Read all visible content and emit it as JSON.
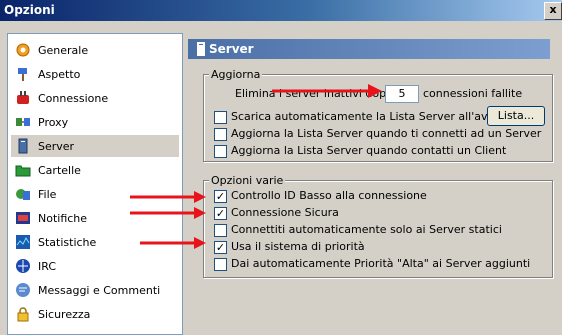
{
  "window": {
    "title": "Opzioni",
    "close_glyph": "x"
  },
  "sidebar": {
    "items": [
      {
        "label": "Generale",
        "icon": "gear-icon"
      },
      {
        "label": "Aspetto",
        "icon": "paint-icon"
      },
      {
        "label": "Connessione",
        "icon": "connection-icon"
      },
      {
        "label": "Proxy",
        "icon": "proxy-icon"
      },
      {
        "label": "Server",
        "icon": "server-icon",
        "selected": true
      },
      {
        "label": "Cartelle",
        "icon": "folder-icon"
      },
      {
        "label": "File",
        "icon": "file-icon"
      },
      {
        "label": "Notifiche",
        "icon": "notification-icon"
      },
      {
        "label": "Statistiche",
        "icon": "statistics-icon"
      },
      {
        "label": "IRC",
        "icon": "irc-icon"
      },
      {
        "label": "Messaggi e Commenti",
        "icon": "messages-icon"
      },
      {
        "label": "Sicurezza",
        "icon": "lock-icon"
      }
    ]
  },
  "header": {
    "title": "Server"
  },
  "aggiorna": {
    "legend": "Aggiorna",
    "remove_prefix": "Elimina i server inattivi dopo",
    "remove_value": "5",
    "remove_suffix": "connessioni fallite",
    "options": [
      {
        "label": "Scarica automaticamente la Lista Server all'avvio",
        "checked": false
      },
      {
        "label": "Aggiorna la Lista Server quando ti connetti ad un Server",
        "checked": false
      },
      {
        "label": "Aggiorna la Lista Server quando contatti un Client",
        "checked": false
      }
    ],
    "list_button": "Lista..."
  },
  "varie": {
    "legend": "Opzioni varie",
    "options": [
      {
        "label": "Controllo ID Basso alla connessione",
        "checked": true
      },
      {
        "label": "Connessione Sicura",
        "checked": true
      },
      {
        "label": "Connettiti automaticamente solo ai Server statici",
        "checked": false
      },
      {
        "label": "Usa il sistema di priorità",
        "checked": true
      },
      {
        "label": "Dai automaticamente Priorità \"Alta\" ai Server aggiunti",
        "checked": false
      }
    ]
  },
  "colors": {
    "arrow": "#e8141b",
    "titlebar": "#0a246a",
    "header": "#4a6fa5"
  }
}
